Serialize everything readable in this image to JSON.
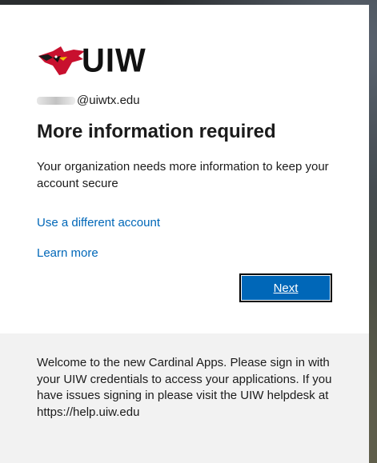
{
  "brand": {
    "name": "UIW",
    "colors": {
      "cardinal_red": "#c8102e",
      "link_blue": "#0067b8",
      "button_blue": "#0067b8"
    },
    "logo_icon": "cardinal-head-icon"
  },
  "account": {
    "email_visible": "@uiwtx.edu"
  },
  "main": {
    "title": "More information required",
    "description": "Your organization needs more information to keep your account secure",
    "use_different_account": "Use a different account",
    "learn_more": "Learn more",
    "next_label": "Next"
  },
  "footer": {
    "message": "Welcome to the new Cardinal Apps. Please sign in with your UIW credentials to access your applications. If you have issues signing in please visit the UIW helpdesk at https://help.uiw.edu"
  }
}
